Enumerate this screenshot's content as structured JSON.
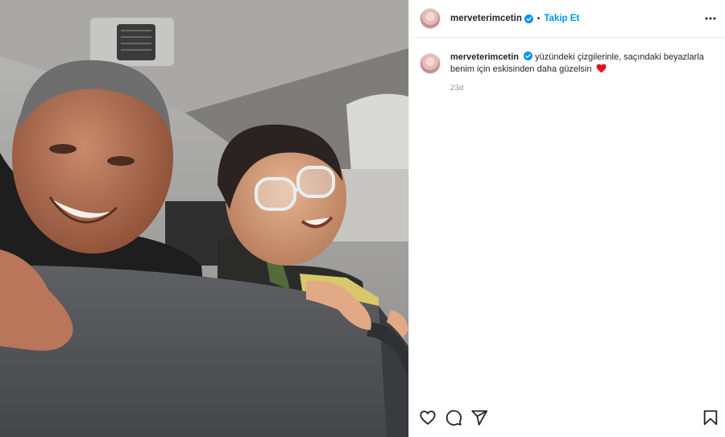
{
  "post": {
    "username": "merveterimcetin",
    "dot": "•",
    "follow_label": "Takip Et",
    "caption": "yüzündeki çizgilerinle, saçındaki beyazlarla benim için eskisinden daha güzelsin",
    "timestamp": "23d"
  },
  "icons": {
    "verified": "verified-badge-icon",
    "more": "more-options-icon",
    "like": "heart-icon",
    "comment": "comment-icon",
    "share": "share-icon",
    "save": "bookmark-icon",
    "caption_emoji": "red-heart-emoji"
  },
  "colors": {
    "accent": "#0095f6",
    "text": "#262626",
    "secondary": "#8e8e8e",
    "border": "#efefef",
    "emoji_heart": "#e0141e"
  }
}
